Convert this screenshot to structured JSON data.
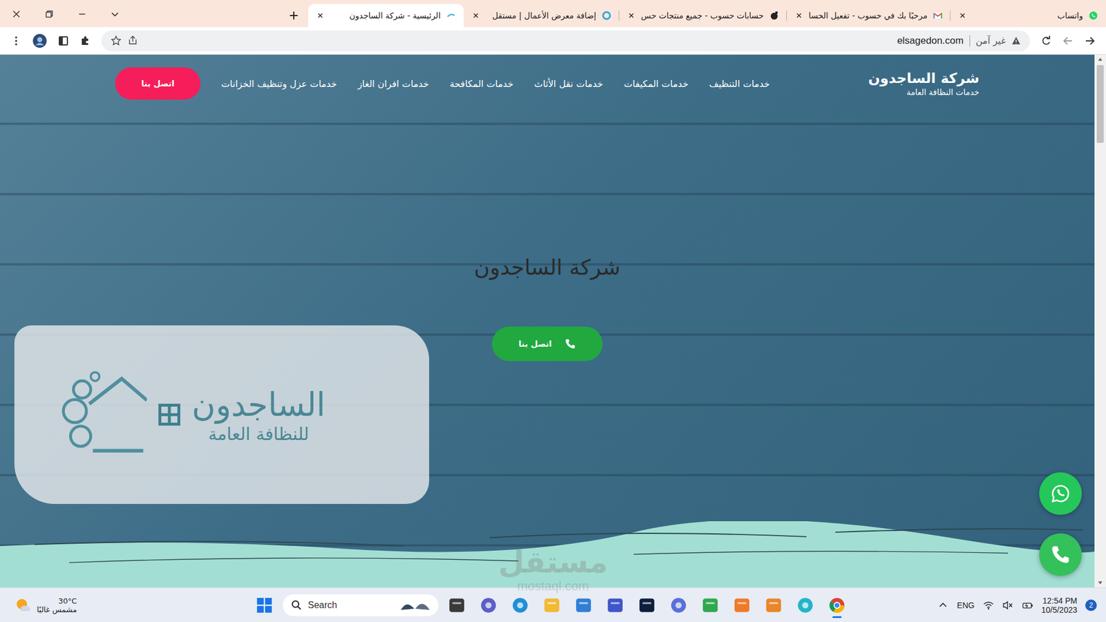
{
  "browser": {
    "tabs": [
      {
        "label": "واتساب",
        "selected": false
      },
      {
        "label": "مرحبًا بك في حسوب - تفعيل الحسا",
        "selected": false
      },
      {
        "label": "حسابات حسوب - جميع منتجات حس",
        "selected": false
      },
      {
        "label": "إضافة معرض الأعمال | مستقل",
        "selected": false
      },
      {
        "label": "الرئيسية - شركة الساجدون",
        "selected": true
      }
    ],
    "address": "elsagedon.com",
    "security": "غير آمن"
  },
  "site": {
    "brand": {
      "name": "شركة الساجدون",
      "tagline": "خدمات النظافة العامة"
    },
    "nav": [
      "خدمات التنظيف",
      "خدمات المكيفات",
      "خدمات نقل الأثاث",
      "خدمات المكافحة",
      "خدمات افران الغاز",
      "خدمات عزل وتنظيف الخزانات"
    ],
    "nav_button": "اتصل بنا",
    "hero": {
      "title": "شركة الساجدون",
      "button": "اتصل بنا"
    },
    "logo": {
      "name": "الساجدون",
      "tagline": "للنظافة العامة"
    }
  },
  "watermark": {
    "text": "مستقل",
    "domain": "mostaql.com"
  },
  "taskbar": {
    "weather": {
      "temp": "30°C",
      "condition": "مشمس غالبًا"
    },
    "search": "Search",
    "language": "ENG",
    "time": "12:54 PM",
    "date": "10/5/2023",
    "notifications": "2"
  }
}
